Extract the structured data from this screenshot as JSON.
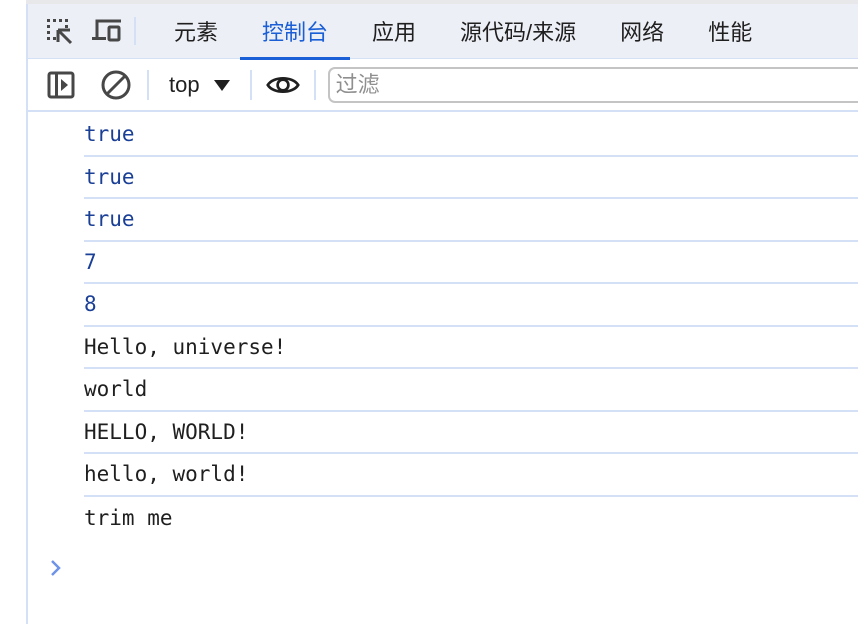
{
  "tabbar": {
    "tabs": [
      {
        "label": "元素",
        "active": false
      },
      {
        "label": "控制台",
        "active": true
      },
      {
        "label": "应用",
        "active": false
      },
      {
        "label": "源代码/来源",
        "active": false
      },
      {
        "label": "网络",
        "active": false
      },
      {
        "label": "性能",
        "active": false
      }
    ],
    "icons": [
      "inspect-element-icon",
      "device-toolbar-icon"
    ]
  },
  "toolbar": {
    "context": "top",
    "filter_placeholder": "过滤",
    "filter_value": ""
  },
  "console": {
    "entries": [
      {
        "text": "true",
        "kind": "value"
      },
      {
        "text": "true",
        "kind": "value"
      },
      {
        "text": "true",
        "kind": "value"
      },
      {
        "text": "7",
        "kind": "value"
      },
      {
        "text": "8",
        "kind": "value"
      },
      {
        "text": "Hello, universe!",
        "kind": "string"
      },
      {
        "text": "world",
        "kind": "string"
      },
      {
        "text": "HELLO, WORLD!",
        "kind": "string"
      },
      {
        "text": "hello, world!",
        "kind": "string"
      },
      {
        "text": "trim me",
        "kind": "string"
      }
    ],
    "prompt_symbol": "›"
  },
  "colors": {
    "accent": "#1a5fd6",
    "value_text": "#1a3f96",
    "divider": "#d3e0f5",
    "tabbar_bg": "#edeff6",
    "prompt": "#6e93e8"
  }
}
